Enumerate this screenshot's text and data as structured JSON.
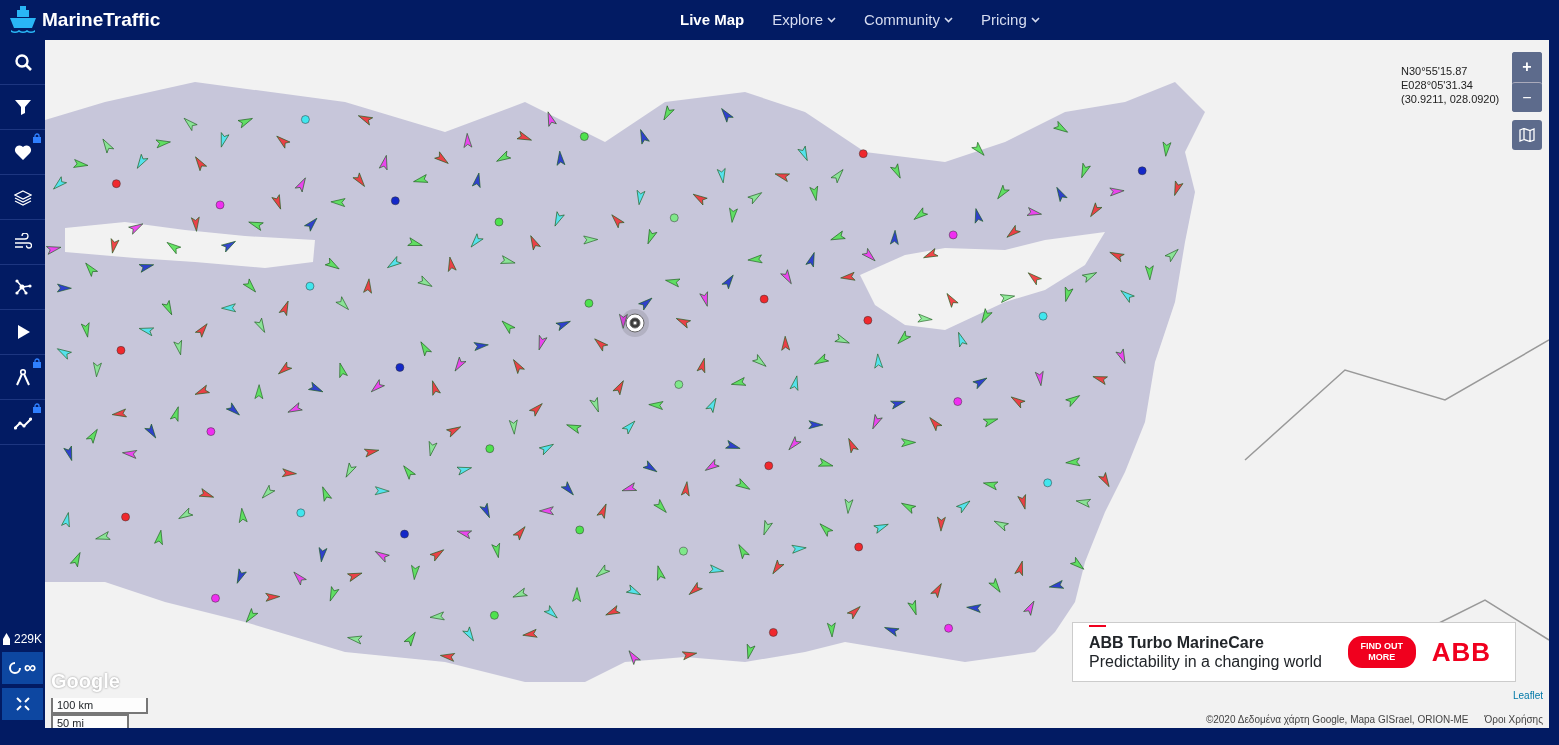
{
  "navbar": {
    "brand": "MarineTraffic",
    "items": [
      {
        "label": "Live Map",
        "selected": true,
        "has_menu": false
      },
      {
        "label": "Explore",
        "selected": false,
        "has_menu": true
      },
      {
        "label": "Community",
        "selected": false,
        "has_menu": true
      },
      {
        "label": "Pricing",
        "selected": false,
        "has_menu": true
      }
    ]
  },
  "sidebar": {
    "items": [
      {
        "kind": "search",
        "locked": false
      },
      {
        "kind": "filter",
        "locked": false
      },
      {
        "kind": "favorites",
        "locked": true
      },
      {
        "kind": "layers",
        "locked": false
      },
      {
        "kind": "weather",
        "locked": false
      },
      {
        "kind": "network",
        "locked": false
      },
      {
        "kind": "play",
        "locked": false
      },
      {
        "kind": "measure",
        "locked": true
      },
      {
        "kind": "analytics",
        "locked": true
      }
    ],
    "vessel_count": "229K",
    "refresh_label": "∞"
  },
  "map": {
    "coordinates": [
      "N30°55'15.87",
      "E028°05'31.34",
      "(30.9211, 028.0920)"
    ],
    "zoom_in": "+",
    "zoom_out": "−",
    "google_label": "Google",
    "scale": [
      "100 km",
      "50 mi"
    ],
    "attribution": {
      "leaflet": "Leaflet",
      "copyright": "©2020 Δεδομένα χάρτη Google, Mapa GISrael, ORION-ME",
      "terms": "Όροι Χρήσης"
    }
  },
  "ad": {
    "title": "ABB Turbo MarineCare",
    "subtitle": "Predictability in a changing world",
    "button": "FIND OUT MORE",
    "logo": "ABB"
  }
}
